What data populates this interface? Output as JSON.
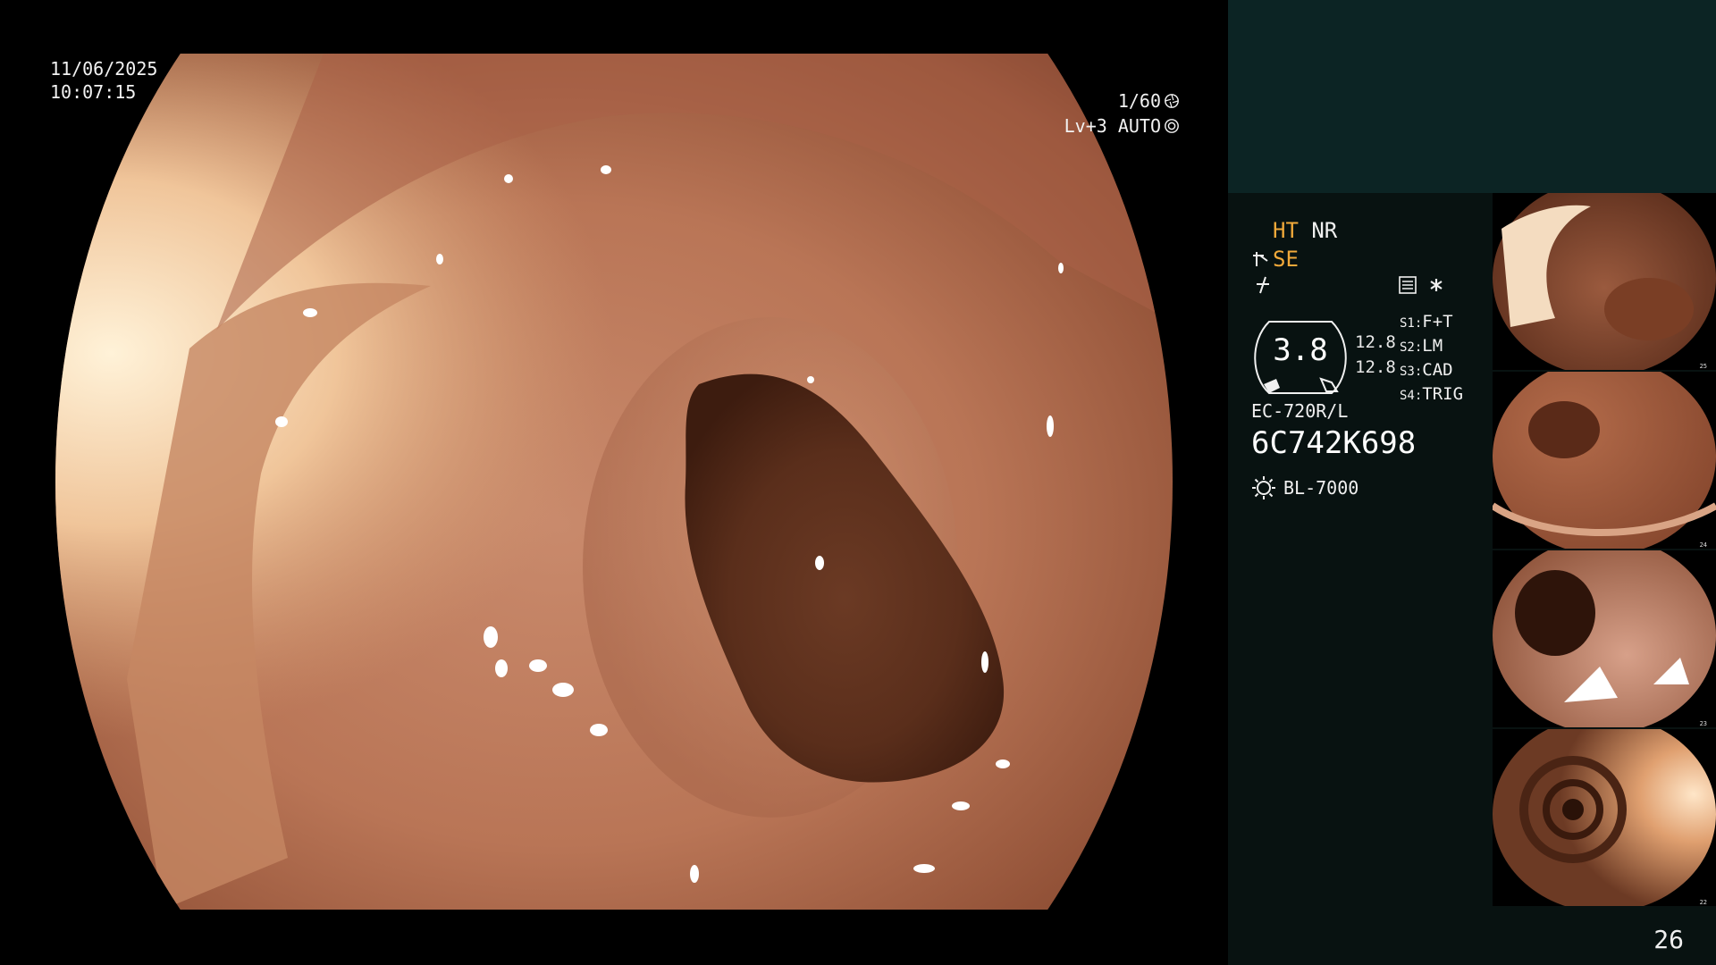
{
  "overlay": {
    "date": "11/06/2025",
    "time": "10:07:15",
    "shutter_speed": "1/60",
    "level_mode": "Lv+3 AUTO"
  },
  "panel": {
    "mode_ht": "HT",
    "mode_nr": "NR",
    "mode_se": "SE",
    "gauge_value": "3.8",
    "gauge_sub_1": "12.8",
    "gauge_sub_2": "12.8",
    "switches": [
      {
        "key": "S1:",
        "value": "F+T"
      },
      {
        "key": "S2:",
        "value": "LM"
      },
      {
        "key": "S3:",
        "value": "CAD"
      },
      {
        "key": "S4:",
        "value": "TRIG"
      }
    ],
    "scope_model": "EC-720R/L",
    "scope_serial": "6C742K698",
    "light_source": "BL-7000",
    "page_number": "26"
  },
  "thumbnails": [
    {
      "index": "25"
    },
    {
      "index": "24"
    },
    {
      "index": "23"
    },
    {
      "index": "22"
    }
  ],
  "colors": {
    "accent_orange": "#f1a93a",
    "panel_top": "#0c2424",
    "panel_bg": "#081211"
  },
  "icons": {
    "shutter": "aperture-icon",
    "auto": "iris-icon",
    "enhance": "structure-enhance-icon",
    "color": "color-mode-icon",
    "memory": "memory-card-icon",
    "star": "asterisk-icon",
    "light": "light-bulb-icon"
  }
}
